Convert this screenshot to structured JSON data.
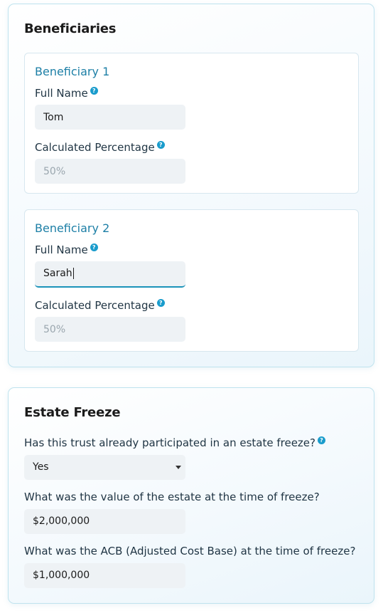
{
  "beneficiaries": {
    "title": "Beneficiaries",
    "items": [
      {
        "heading": "Beneficiary 1",
        "full_name_label": "Full Name",
        "full_name_value": "Tom",
        "percentage_label": "Calculated Percentage",
        "percentage_value": "50%"
      },
      {
        "heading": "Beneficiary 2",
        "full_name_label": "Full Name",
        "full_name_value": "Sarah",
        "percentage_label": "Calculated Percentage",
        "percentage_value": "50%"
      }
    ]
  },
  "estate_freeze": {
    "title": "Estate Freeze",
    "participated_question": "Has this trust already participated in an estate freeze?",
    "participated_value": "Yes",
    "value_question": "What was the value of the estate at the time of freeze?",
    "value_amount": "$2,000,000",
    "acb_question": "What was the ACB (Adjusted Cost Base) at the time of freeze?",
    "acb_amount": "$1,000,000"
  },
  "icons": {
    "help": "?"
  },
  "colors": {
    "accent": "#1d7fa6",
    "help_icon": "#1a9ccc",
    "input_bg": "#eef2f5",
    "focus_underline": "#1b93b9"
  }
}
